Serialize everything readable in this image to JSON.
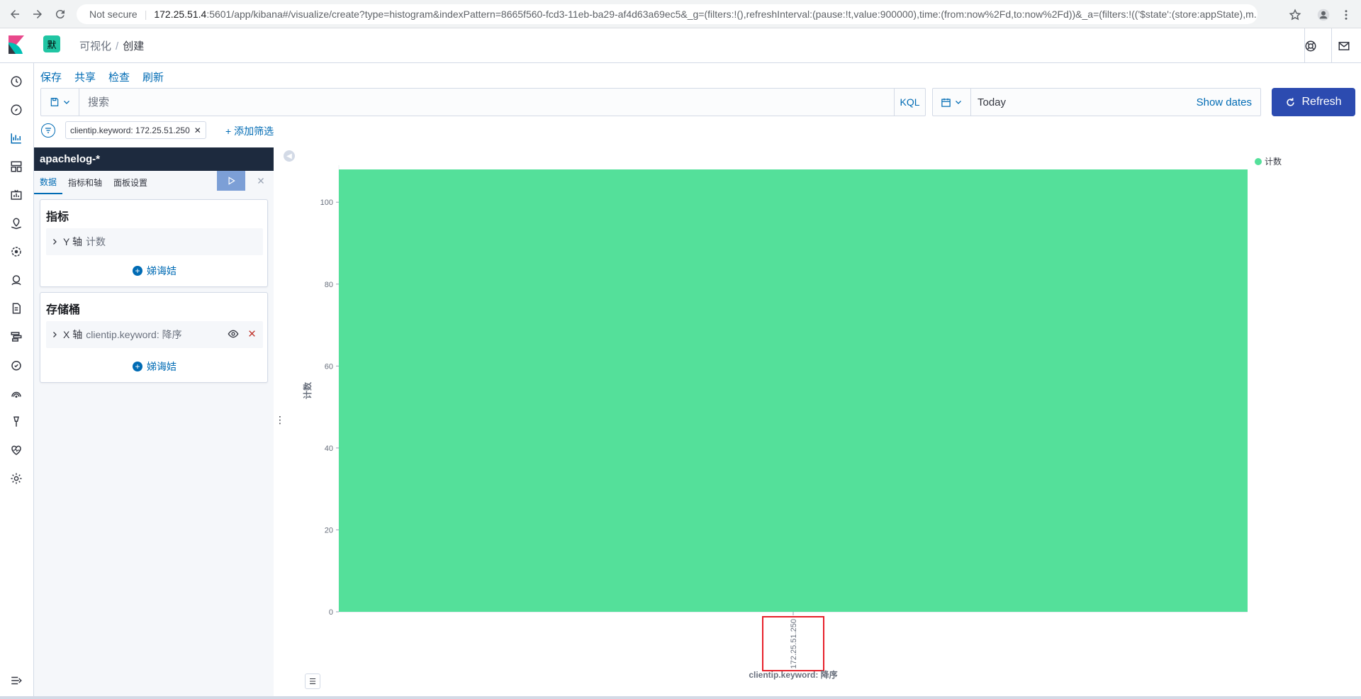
{
  "browser": {
    "security_label": "Not secure",
    "url_host": "172.25.51.4",
    "url_rest": ":5601/app/kibana#/visualize/create?type=histogram&indexPattern=8665f560-fcd3-11eb-ba29-af4d63a69ec5&_g=(filters:!(),refreshInterval:(pause:!t,value:900000),time:(from:now%2Fd,to:now%2Fd))&_a=(filters:!(('$state':(store:appState),m..."
  },
  "header": {
    "space_initial": "默",
    "breadcrumb_parent": "可视化",
    "breadcrumb_sep": "/",
    "breadcrumb_current": "创建"
  },
  "top_menu": {
    "save": "保存",
    "share": "共享",
    "inspect": "检查",
    "refresh": "刷新"
  },
  "query": {
    "placeholder": "搜索",
    "language": "KQL"
  },
  "date": {
    "value": "Today",
    "show_dates": "Show dates",
    "refresh_label": "Refresh"
  },
  "filters": {
    "pill_label": "clientip.keyword: 172.25.51.250",
    "add_filter": "+ 添加筛选"
  },
  "sidebar": {
    "index_pattern": "apachelog-*",
    "tabs": [
      "数据",
      "指标和轴",
      "面板设置"
    ],
    "metrics_title": "指标",
    "metric_row_axis": "Y 轴",
    "metric_row_desc": "计数",
    "add_label": "娣诲姞",
    "buckets_title": "存储桶",
    "bucket_row_axis": "X 轴",
    "bucket_row_desc": "clientip.keyword: 降序"
  },
  "chart_data": {
    "type": "bar",
    "categories": [
      "172.25.51.250"
    ],
    "series": [
      {
        "name": "计数",
        "values": [
          108
        ]
      }
    ],
    "xlabel": "clientip.keyword: 降序",
    "ylabel": "计数",
    "ylim": [
      0,
      108
    ],
    "yticks": [
      0,
      20,
      40,
      60,
      80,
      100
    ],
    "color": "#54e09a",
    "legend_position": "top-right",
    "highlight_color": "#e7202a"
  }
}
